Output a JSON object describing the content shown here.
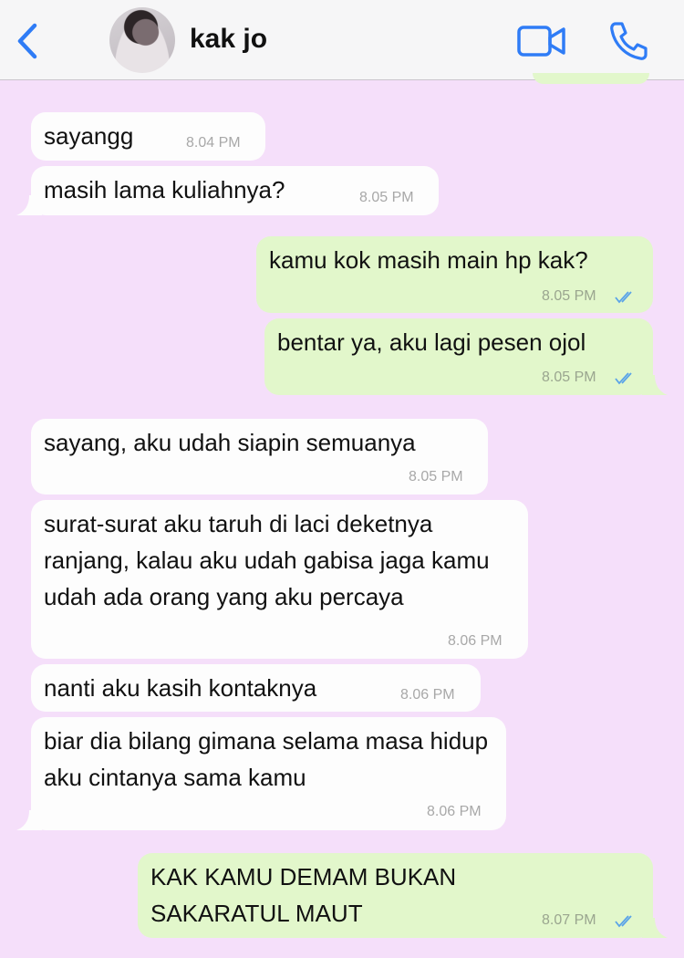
{
  "header": {
    "contact_name": "kak jo",
    "back_icon": "chevron-left-icon",
    "video_icon": "video-camera-icon",
    "call_icon": "phone-icon",
    "accent_color": "#2f7cf6"
  },
  "messages": [
    {
      "direction": "incoming",
      "text": "sayangg",
      "time": "8.04 PM"
    },
    {
      "direction": "incoming",
      "text": "masih lama kuliahnya?",
      "time": "8.05 PM"
    },
    {
      "direction": "outgoing",
      "text": "kamu kok masih main hp kak?",
      "time": "8.05 PM",
      "status": "read"
    },
    {
      "direction": "outgoing",
      "text": "bentar ya, aku lagi pesen ojol",
      "time": "8.05 PM",
      "status": "read"
    },
    {
      "direction": "incoming",
      "text": "sayang, aku udah siapin semuanya",
      "time": "8.05 PM"
    },
    {
      "direction": "incoming",
      "text": "surat-surat aku taruh di laci deketnya ranjang, kalau aku udah gabisa jaga kamu udah ada orang yang aku percaya",
      "time": "8.06 PM"
    },
    {
      "direction": "incoming",
      "text": "nanti aku kasih kontaknya",
      "time": "8.06 PM"
    },
    {
      "direction": "incoming",
      "text": "biar dia bilang gimana selama masa hidup aku cintanya sama kamu",
      "time": "8.06 PM"
    },
    {
      "direction": "outgoing",
      "text": "KAK KAMU DEMAM BUKAN SAKARATUL MAUT",
      "time": "8.07 PM",
      "status": "read"
    }
  ],
  "colors": {
    "chat_background": "#f5dffa",
    "incoming_bubble": "#fdfdfd",
    "outgoing_bubble": "#e2f7cb",
    "read_tick": "#5aa3e8"
  }
}
